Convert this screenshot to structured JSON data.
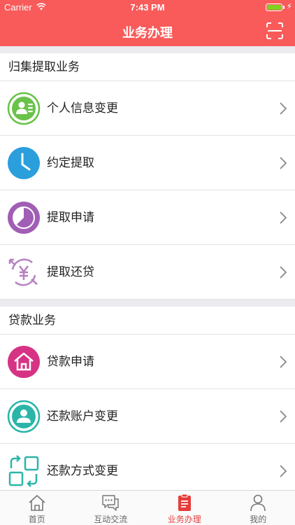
{
  "status_bar": {
    "carrier": "Carrier",
    "time": "7:43 PM"
  },
  "header": {
    "title": "业务办理",
    "scan_icon": "scan-icon"
  },
  "sections": [
    {
      "title": "归集提取业务",
      "items": [
        {
          "label": "个人信息变更",
          "icon": "user-info-icon",
          "color": "#6ac24a"
        },
        {
          "label": "约定提取",
          "icon": "clock-icon",
          "color": "#2a9fdc"
        },
        {
          "label": "提取申请",
          "icon": "pie-icon",
          "color": "#a05eb5"
        },
        {
          "label": "提取还贷",
          "icon": "yuan-cycle-icon",
          "color": "#b77fc2"
        }
      ]
    },
    {
      "title": "贷款业务",
      "items": [
        {
          "label": "贷款申请",
          "icon": "house-icon",
          "color": "#d63384"
        },
        {
          "label": "还款账户变更",
          "icon": "account-user-icon",
          "color": "#2bb5a8"
        },
        {
          "label": "还款方式变更",
          "icon": "switch-mode-icon",
          "color": "#2bb5a8"
        }
      ]
    }
  ],
  "tabbar": {
    "tabs": [
      {
        "label": "首页",
        "icon": "home-icon"
      },
      {
        "label": "互动交流",
        "icon": "chat-icon"
      },
      {
        "label": "业务办理",
        "icon": "clipboard-icon"
      },
      {
        "label": "我的",
        "icon": "person-icon"
      }
    ],
    "active_index": 2,
    "active_color": "#e63c3c"
  },
  "colors": {
    "brand": "#f95a5a",
    "separator": "#ebebf0"
  }
}
